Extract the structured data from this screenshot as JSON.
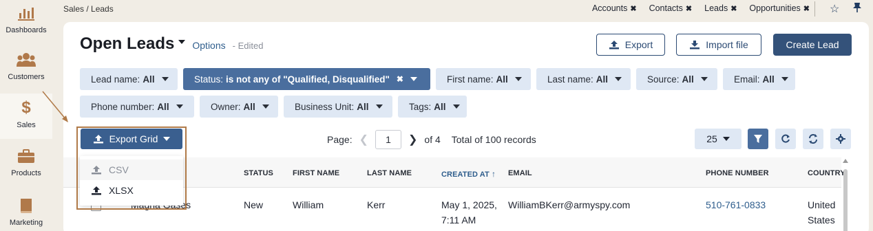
{
  "nav": {
    "items": [
      {
        "label": "Dashboards",
        "icon": "bar-chart-icon"
      },
      {
        "label": "Customers",
        "icon": "users-icon"
      },
      {
        "label": "Sales",
        "icon": "dollar-icon"
      },
      {
        "label": "Products",
        "icon": "briefcase-icon"
      },
      {
        "label": "Marketing",
        "icon": "book-icon"
      }
    ]
  },
  "breadcrumb": "Sales / Leads",
  "pinned_tabs": [
    "Accounts",
    "Contacts",
    "Leads",
    "Opportunities"
  ],
  "header": {
    "title": "Open Leads",
    "options_label": "Options",
    "edited_label": "- Edited",
    "export_label": "Export",
    "import_label": "Import file",
    "create_label": "Create Lead"
  },
  "filters": {
    "lead_name": {
      "label": "Lead name:",
      "value": "All"
    },
    "status": {
      "label": "Status:",
      "value": "is not any of \"Qualified, Disqualified\""
    },
    "first_name": {
      "label": "First name:",
      "value": "All"
    },
    "last_name": {
      "label": "Last name:",
      "value": "All"
    },
    "source": {
      "label": "Source:",
      "value": "All"
    },
    "email": {
      "label": "Email:",
      "value": "All"
    },
    "phone_number": {
      "label": "Phone number:",
      "value": "All"
    },
    "owner": {
      "label": "Owner:",
      "value": "All"
    },
    "business_unit": {
      "label": "Business Unit:",
      "value": "All"
    },
    "tags": {
      "label": "Tags:",
      "value": "All"
    }
  },
  "export_grid": {
    "label": "Export Grid",
    "options": [
      "CSV",
      "XLSX"
    ]
  },
  "pager": {
    "page_label": "Page:",
    "current_page": "1",
    "of_label": "of 4",
    "total_label": "Total of 100 records"
  },
  "page_size": "25",
  "grid": {
    "headers": {
      "status": "STATUS",
      "first_name": "FIRST NAME",
      "last_name": "LAST NAME",
      "created_at": "CREATED AT",
      "email": "EMAIL",
      "phone": "PHONE NUMBER",
      "country": "COUNTRY"
    },
    "row": {
      "lead_name": "Magna Gases",
      "status": "New",
      "first_name": "William",
      "last_name": "Kerr",
      "created_date": "May 1, 2025,",
      "created_time": "7:11 AM",
      "email": "WilliamBKerr@armyspy.com",
      "phone": "510-761-0833",
      "country_line1": "United",
      "country_line2": "States"
    }
  },
  "colors": {
    "accent": "#34527a",
    "chip_bg": "#dfe8f4",
    "chip_active": "#4a6e9e",
    "annotation": "#b07a48"
  }
}
